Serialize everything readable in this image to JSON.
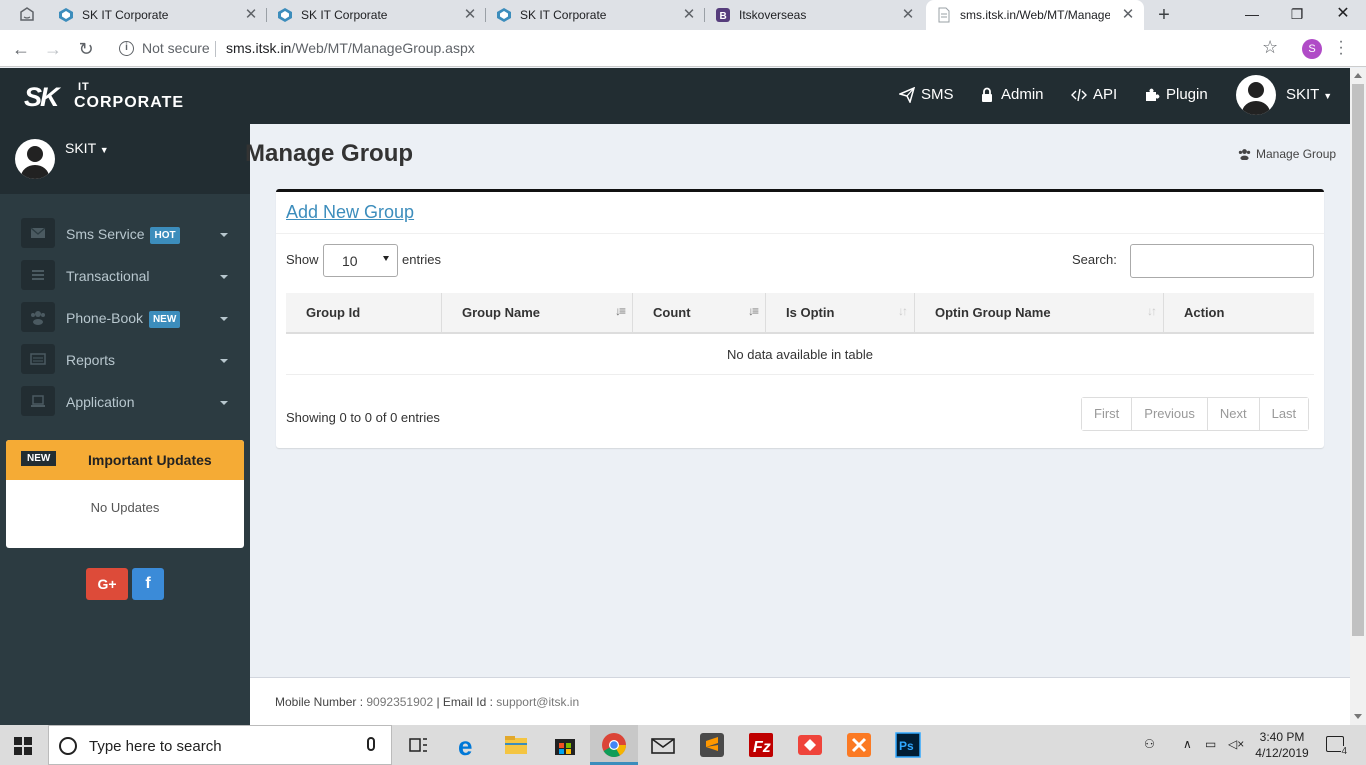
{
  "browser": {
    "tabs": [
      {
        "title": "SK IT Corporate"
      },
      {
        "title": "SK IT Corporate"
      },
      {
        "title": "SK IT Corporate"
      },
      {
        "title": "Itskoverseas"
      },
      {
        "title": "sms.itsk.in/Web/MT/ManageG"
      }
    ],
    "security_label": "Not secure",
    "url_host": "sms.itsk.in",
    "url_path": "/Web/MT/ManageGroup.aspx",
    "profile_initial": "S"
  },
  "header": {
    "logo_sk": "SK",
    "logo_it": "IT",
    "logo_corp": "CORPORATE",
    "nav": {
      "sms": "SMS",
      "admin": "Admin",
      "api": "API",
      "plugin": "Plugin",
      "user": "SKIT"
    }
  },
  "sidebar": {
    "user": "SKIT",
    "items": [
      {
        "label": "Sms Service",
        "badge": "HOT"
      },
      {
        "label": "Transactional",
        "badge": ""
      },
      {
        "label": "Phone-Book",
        "badge": "NEW"
      },
      {
        "label": "Reports",
        "badge": ""
      },
      {
        "label": "Application",
        "badge": ""
      }
    ],
    "updates": {
      "tag": "NEW",
      "title": "Important Updates",
      "body": "No Updates"
    },
    "social": {
      "gplus": "G+",
      "facebook": "f"
    }
  },
  "page": {
    "title": "Manage Group",
    "breadcrumb": "Manage Group",
    "add_link": "Add New Group",
    "show_label": "Show",
    "page_length": "10",
    "entries_label": "entries",
    "search_label": "Search:",
    "search_value": "",
    "columns": [
      "Group Id",
      "Group Name",
      "Count",
      "Is Optin",
      "Optin Group Name",
      "Action"
    ],
    "empty_message": "No data available in table",
    "info": "Showing 0 to 0 of 0 entries",
    "pager": {
      "first": "First",
      "previous": "Previous",
      "next": "Next",
      "last": "Last"
    }
  },
  "footer": {
    "mobile_label": "Mobile Number : ",
    "mobile_value": "9092351902",
    "email_label": " | Email Id : ",
    "email_value": "support@itsk.in"
  },
  "taskbar": {
    "search_placeholder": "Type here to search",
    "time": "3:40 PM",
    "date": "4/12/2019",
    "notification_count": "4"
  },
  "colors": {
    "header_bg": "#222d32",
    "sidebar_bg": "#2c3b41",
    "accent": "#3c8dbc",
    "updates_bg": "#f5ab35",
    "gplus": "#dd4b39",
    "facebook": "#3b8bd8"
  }
}
